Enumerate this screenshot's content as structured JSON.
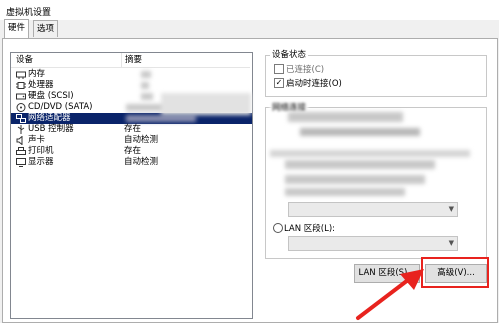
{
  "window": {
    "title": "虚拟机设置"
  },
  "tabs": [
    {
      "label": "硬件"
    },
    {
      "label": "选项"
    }
  ],
  "device_list": {
    "headers": {
      "device": "设备",
      "summary": "摘要"
    },
    "rows": [
      {
        "icon": "memory-icon",
        "name": "内存",
        "summary": ""
      },
      {
        "icon": "cpu-icon",
        "name": "处理器",
        "summary": ""
      },
      {
        "icon": "disk-icon",
        "name": "硬盘 (SCSI)",
        "summary": ""
      },
      {
        "icon": "cd-icon",
        "name": "CD/DVD (SATA)",
        "summary": ""
      },
      {
        "icon": "network-icon",
        "name": "网络适配器",
        "summary": "",
        "selected": true
      },
      {
        "icon": "usb-icon",
        "name": "USB 控制器",
        "summary": "存在"
      },
      {
        "icon": "sound-icon",
        "name": "声卡",
        "summary": "自动检测"
      },
      {
        "icon": "printer-icon",
        "name": "打印机",
        "summary": "存在"
      },
      {
        "icon": "display-icon",
        "name": "显示器",
        "summary": "自动检测"
      }
    ]
  },
  "device_status": {
    "title": "设备状态",
    "connected": {
      "label": "已连接(C)",
      "checked": false
    },
    "connect_on_power_on": {
      "label": "启动时连接(O)",
      "checked": true
    }
  },
  "network_connection": {
    "title": "网络连接",
    "lan_segment": {
      "label": "LAN 区段(L):"
    }
  },
  "buttons": {
    "lan_segments": "LAN 区段(S)...",
    "advanced": "高级(V)..."
  },
  "colors": {
    "selection": "#0a246a",
    "highlight_box": "#e8231e"
  }
}
